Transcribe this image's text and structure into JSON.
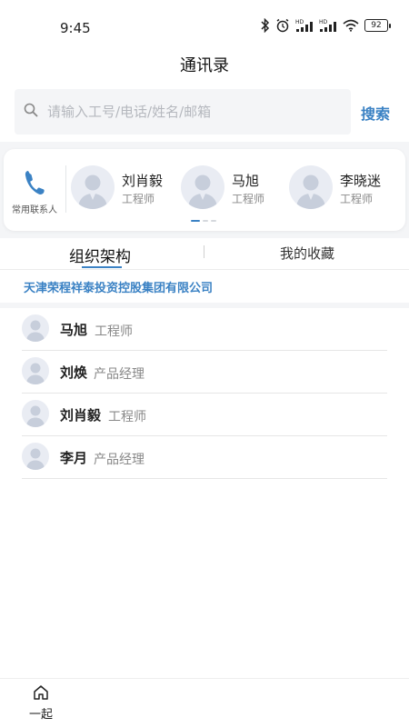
{
  "status_bar": {
    "time": "9:45",
    "battery": "92"
  },
  "page": {
    "title": "通讯录"
  },
  "search": {
    "placeholder": "请输入工号/电话/姓名/邮箱",
    "button_label": "搜索"
  },
  "frequent": {
    "label": "常用联系人",
    "contacts": [
      {
        "name": "刘肖毅",
        "title": "工程师"
      },
      {
        "name": "马旭",
        "title": "工程师"
      },
      {
        "name": "李晓迷",
        "title": "工程师"
      }
    ],
    "page_count": 3,
    "active_page": 1
  },
  "tabs": [
    {
      "label": "组织架构",
      "active": true
    },
    {
      "label": "我的收藏",
      "active": false
    }
  ],
  "org": {
    "company": "天津荣程祥泰投资控股集团有限公司",
    "members": [
      {
        "name": "马旭",
        "title": "工程师"
      },
      {
        "name": "刘焕",
        "title": "产品经理"
      },
      {
        "name": "刘肖毅",
        "title": "工程师"
      },
      {
        "name": "李月",
        "title": "产品经理"
      }
    ]
  },
  "bottom_nav": {
    "home_label": "一起"
  },
  "colors": {
    "accent": "#3b82c4",
    "muted": "#888888",
    "panel": "#f4f5f7"
  },
  "icons": {
    "search": "search-icon",
    "phone": "phone-icon",
    "home": "home-icon",
    "avatar": "avatar-placeholder-icon"
  }
}
